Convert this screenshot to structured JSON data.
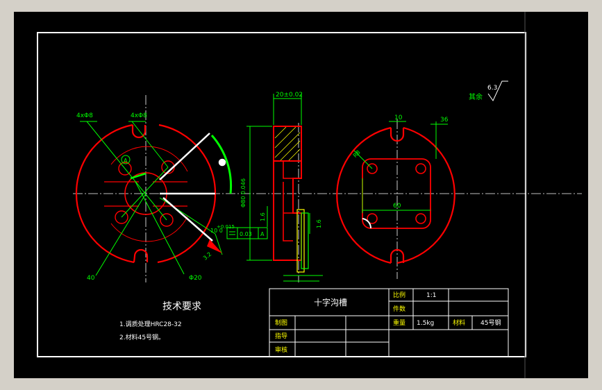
{
  "colors": {
    "background": "#000000",
    "frame": "#ffffff",
    "outline": "#ff0000",
    "dimension": "#00ff00",
    "centerline": "#ffffff",
    "hatch": "#ffff00"
  },
  "roughness": {
    "label": "其余",
    "value": "6.3"
  },
  "front_view": {
    "hole_note_left": "4xΦ8",
    "hole_note_right": "4xΦ8",
    "datum_label": "A",
    "dim_bottom_left": "40",
    "dim_bottom_right": "Φ20",
    "dim_angle": "3.2",
    "tol_upper": "+0.015",
    "tol_base": "10 0",
    "flatness_value": "0.03",
    "flatness_datum": "A"
  },
  "section_view": {
    "width_dim": "20±0.02",
    "height_dim": "Φ80 0.046",
    "step_left": "1.6",
    "step_right": "1.6"
  },
  "top_view": {
    "dim_slot": "10",
    "dim_offset": "36",
    "dim_radius": "R8",
    "dim_width": "60"
  },
  "tech_requirements": {
    "title": "技术要求",
    "items": [
      "1.调质处理HRC28-32",
      "2.材料45号钢。"
    ]
  },
  "title_block": {
    "part_name": "十字沟槽",
    "scale_label": "比例",
    "scale_value": "1:1",
    "qty_label": "件数",
    "weight_label": "重量",
    "weight_value": "1.5kg",
    "material_label": "材料",
    "material_value": "45号钢",
    "drawn_label": "制图",
    "guided_label": "指导",
    "review_label": "审核"
  }
}
